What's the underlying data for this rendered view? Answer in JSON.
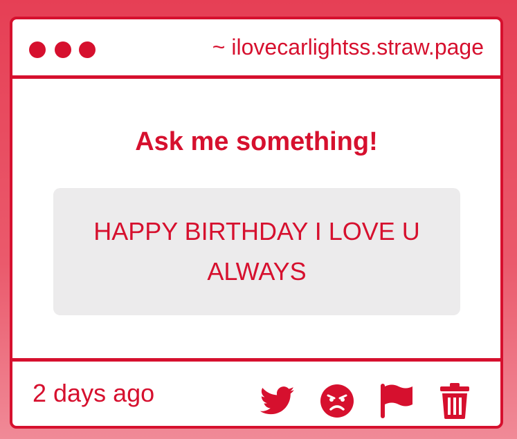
{
  "window": {
    "url": "~ ilovecarlightss.straw.page"
  },
  "main": {
    "heading": "Ask me something!",
    "message": "HAPPY BIRTHDAY I LOVE U ALWAYS"
  },
  "footer": {
    "timestamp": "2 days ago",
    "icons": [
      "twitter-icon",
      "angry-face-icon",
      "flag-icon",
      "trash-icon"
    ]
  },
  "colors": {
    "accent": "#d6102e",
    "message_bg": "#ecebec",
    "page_bg_top": "#e63f55",
    "page_bg_bottom": "#f08a97"
  }
}
